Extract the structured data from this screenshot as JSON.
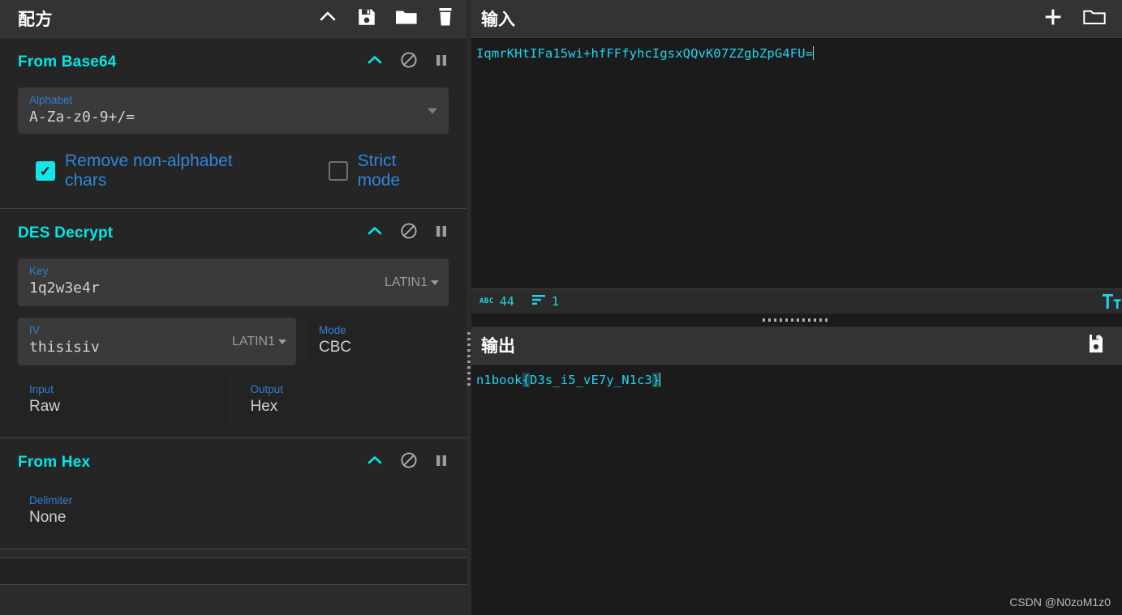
{
  "recipe": {
    "title": "配方",
    "icons": [
      {
        "name": "collapse-icon",
        "glyph": "chevron-up"
      },
      {
        "name": "save-recipe-icon",
        "glyph": "floppy-disk"
      },
      {
        "name": "load-recipe-icon",
        "glyph": "folder"
      },
      {
        "name": "clear-recipe-icon",
        "glyph": "trash"
      }
    ],
    "operations": [
      {
        "id": "from-base64",
        "name": "From Base64",
        "controls": {
          "alphabet_label": "Alphabet",
          "alphabet_value": "A-Za-z0-9+/=",
          "remove_non_alphabet_label": "Remove non-alphabet chars",
          "remove_non_alphabet_checked": true,
          "strict_mode_label": "Strict mode",
          "strict_mode_checked": false
        }
      },
      {
        "id": "des-decrypt",
        "name": "DES Decrypt",
        "controls": {
          "key_label": "Key",
          "key_value": "1q2w3e4r",
          "key_encoding": "LATIN1",
          "iv_label": "IV",
          "iv_value": "thisisiv",
          "iv_encoding": "LATIN1",
          "mode_label": "Mode",
          "mode_value": "CBC",
          "input_label": "Input",
          "input_value": "Raw",
          "output_label": "Output",
          "output_value": "Hex"
        }
      },
      {
        "id": "from-hex",
        "name": "From Hex",
        "controls": {
          "delimiter_label": "Delimiter",
          "delimiter_value": "None"
        }
      }
    ],
    "op_icons": [
      {
        "name": "operation-collapse-icon",
        "glyph": "chevron-up"
      },
      {
        "name": "operation-disable-icon",
        "glyph": "circle-slash"
      },
      {
        "name": "operation-breakpoint-icon",
        "glyph": "pause"
      }
    ]
  },
  "input": {
    "title": "输入",
    "text": "IqmrKHtIFa15wi+hfFFfyhcIgsxQQvK07ZZgbZpG4FU=",
    "add_tab_label": "+",
    "open_file_label": "folder",
    "status": {
      "length_icon": "ABC",
      "length": "44",
      "lines_icon": "lines",
      "lines": "1",
      "format_icon": "Tt"
    }
  },
  "output": {
    "title": "输出",
    "text_before": "n1book",
    "brace_open": "{",
    "text_inner": "D3s_i5_vE7y_N1c3",
    "brace_close": "}",
    "save_icon": "floppy-disk"
  },
  "watermark": "CSDN @N0zoM1z0",
  "colors": {
    "accent_cyan": "#00e8e8",
    "text_cyan": "#22d3ee",
    "label_blue": "#2f80d0",
    "panel_header": "#333333",
    "panel_bg": "#2b2b2b",
    "op_bg": "#252525",
    "editor_bg": "#1b1b1b"
  }
}
